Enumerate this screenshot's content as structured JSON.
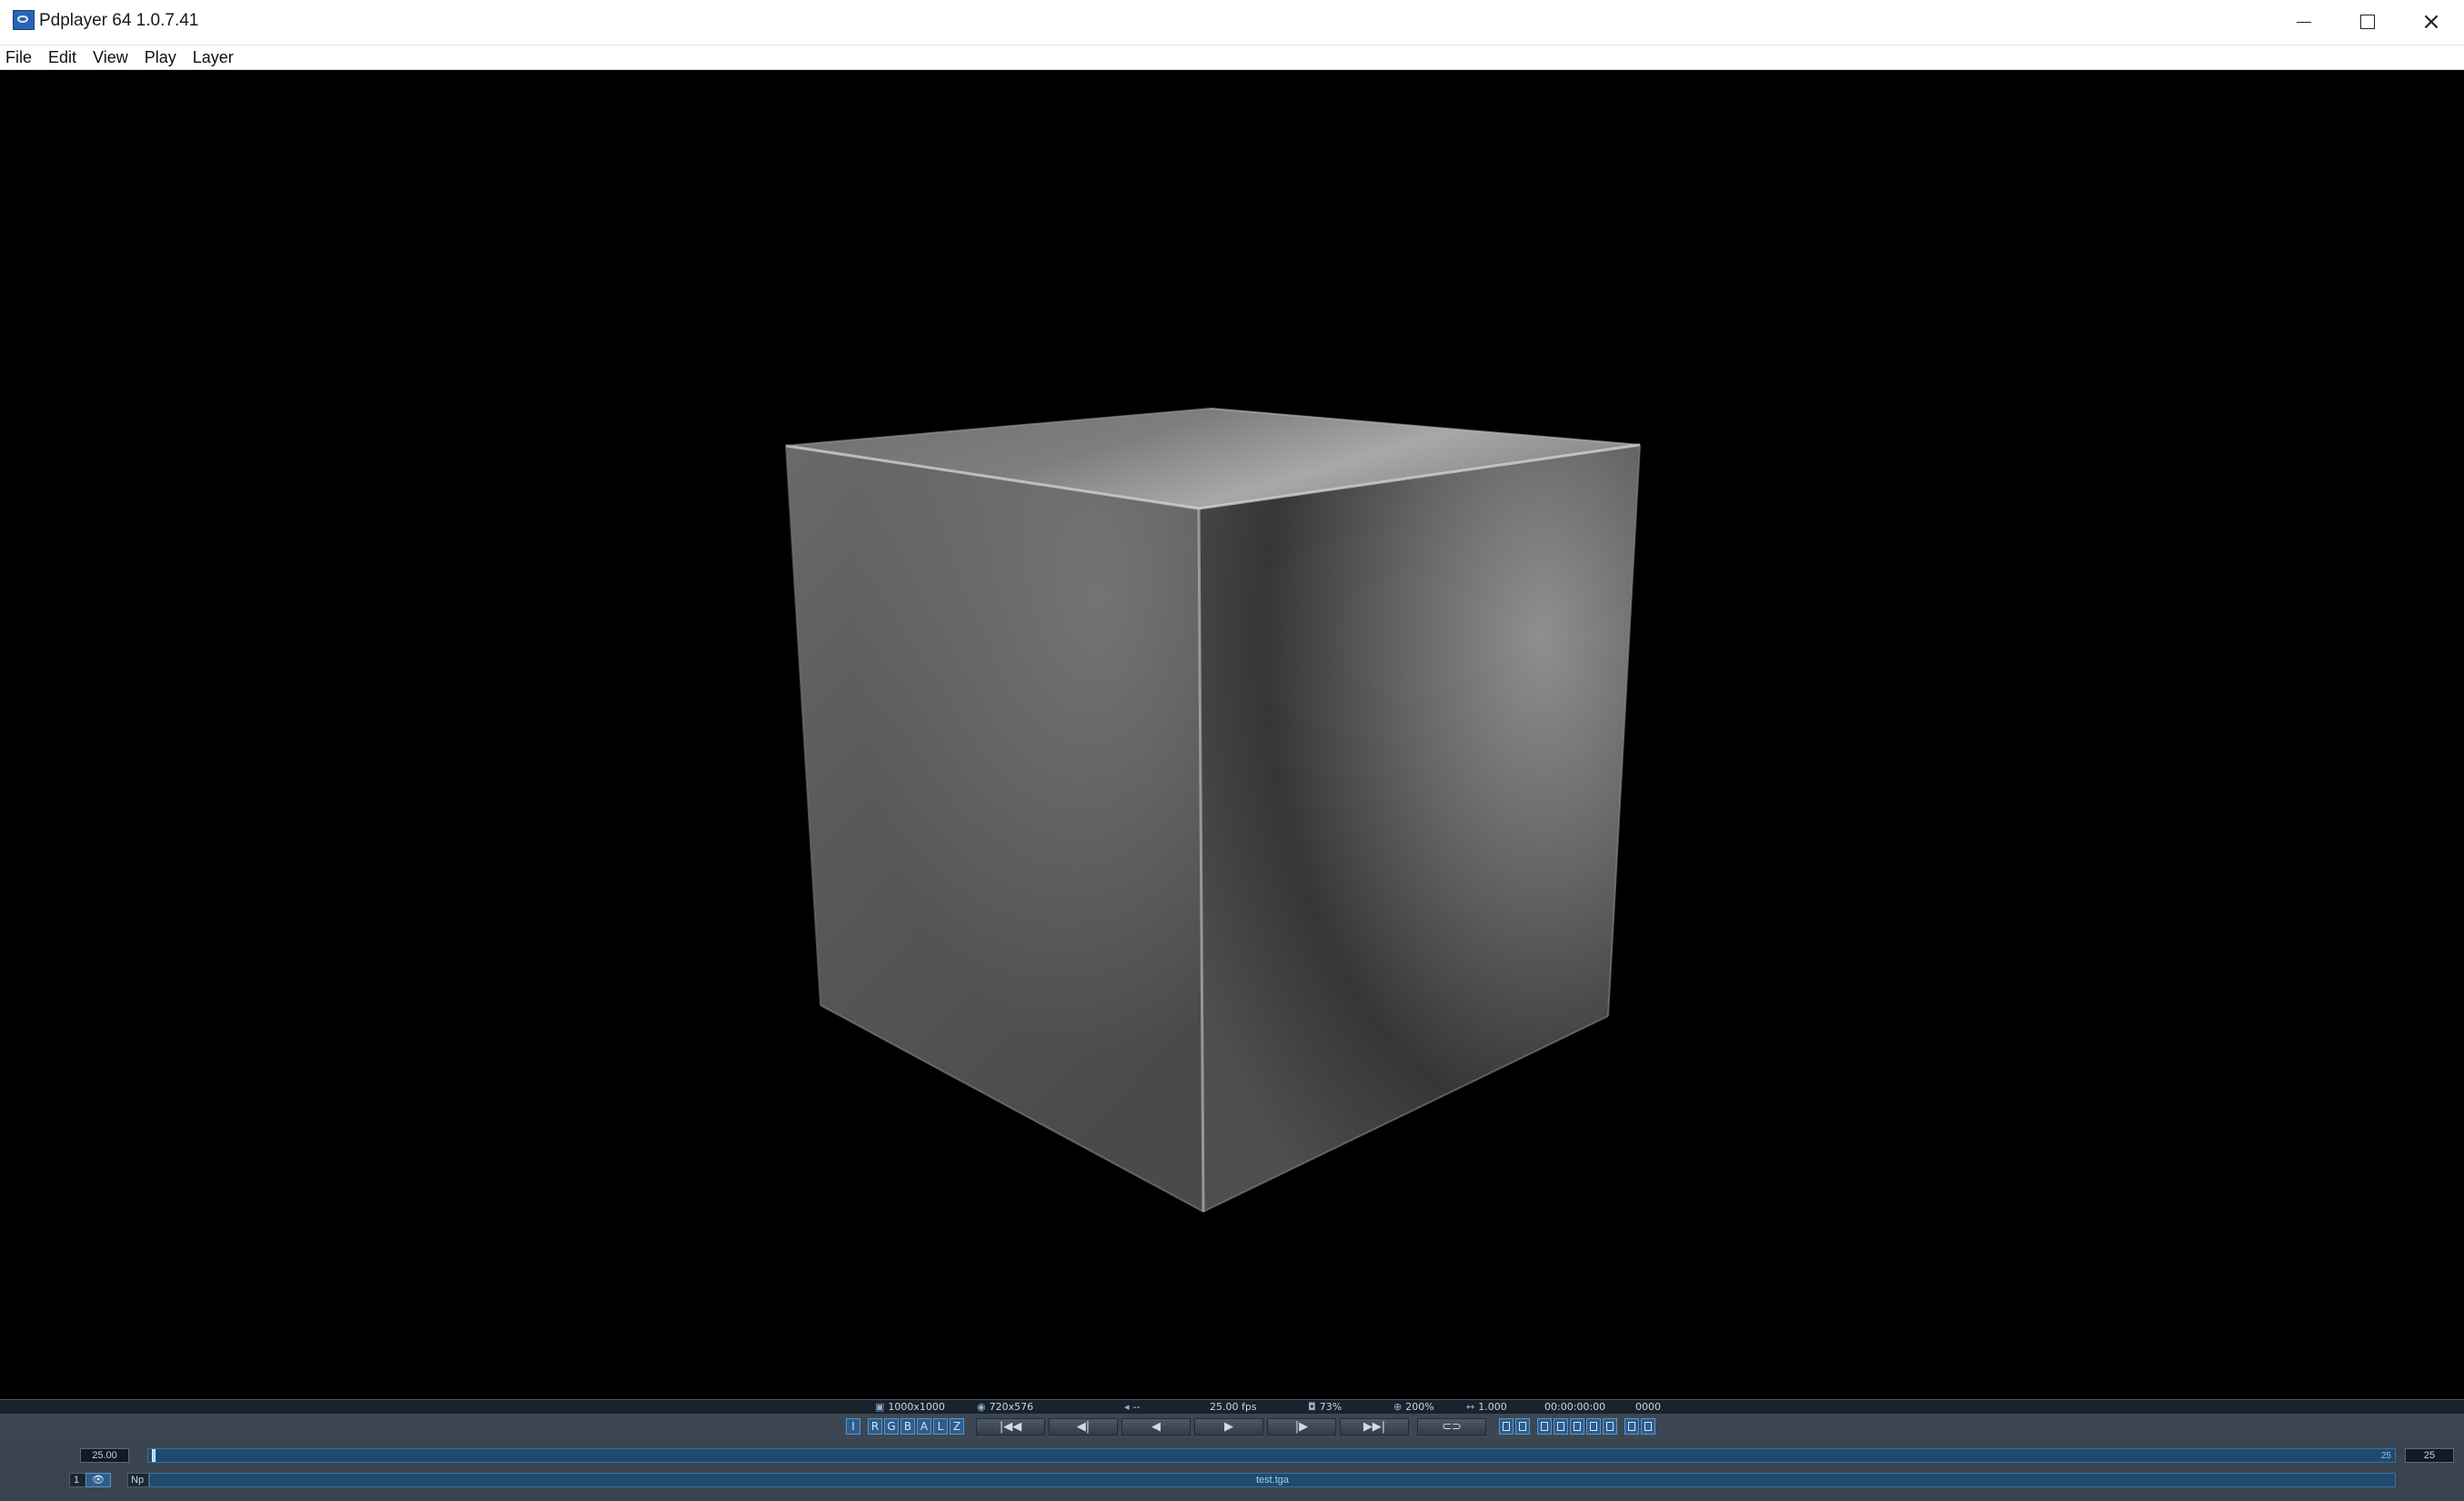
{
  "window": {
    "title": "Pdplayer 64 1.0.7.41",
    "icon": "pdplayer-app-icon",
    "controls": {
      "minimize": "minimize-icon",
      "maximize": "maximize-icon",
      "close": "×"
    }
  },
  "menu": [
    {
      "label": "File"
    },
    {
      "label": "Edit"
    },
    {
      "label": "View"
    },
    {
      "label": "Play"
    },
    {
      "label": "Layer"
    }
  ],
  "viewport": {
    "content": "rendered-grey-cube",
    "background_color": "#000000"
  },
  "info_bar": {
    "composition_size": "1000x1000",
    "output_size": "720x576",
    "audio": "--",
    "fps": "25.00 fps",
    "cache": "73%",
    "zoom": "200%",
    "aspect": "1.000",
    "timecode": "00:00:00:00",
    "frame": "0000"
  },
  "channel_buttons": [
    "I",
    "R",
    "G",
    "B",
    "A",
    "L",
    "Z"
  ],
  "transport": {
    "first_frame": "|◀◀",
    "step_back": "◀|",
    "play_backward": "◀",
    "play_forward": "▶",
    "step_forward": "|▶",
    "last_frame": "▶▶|",
    "loop": "⊂⊃"
  },
  "timeline": {
    "fps_value": "25.00",
    "end_frame_marker": "25",
    "end_frame": "25",
    "playhead_frame": 0
  },
  "layer": {
    "number": "1",
    "visibility_icon": "eye-icon",
    "mode": "Np",
    "clip_name": "test.tga"
  },
  "colors": {
    "panel": "#3a4450",
    "info_strip": "#1a222b",
    "accent": "#2d5d8c",
    "track": "#1f4a6e"
  }
}
